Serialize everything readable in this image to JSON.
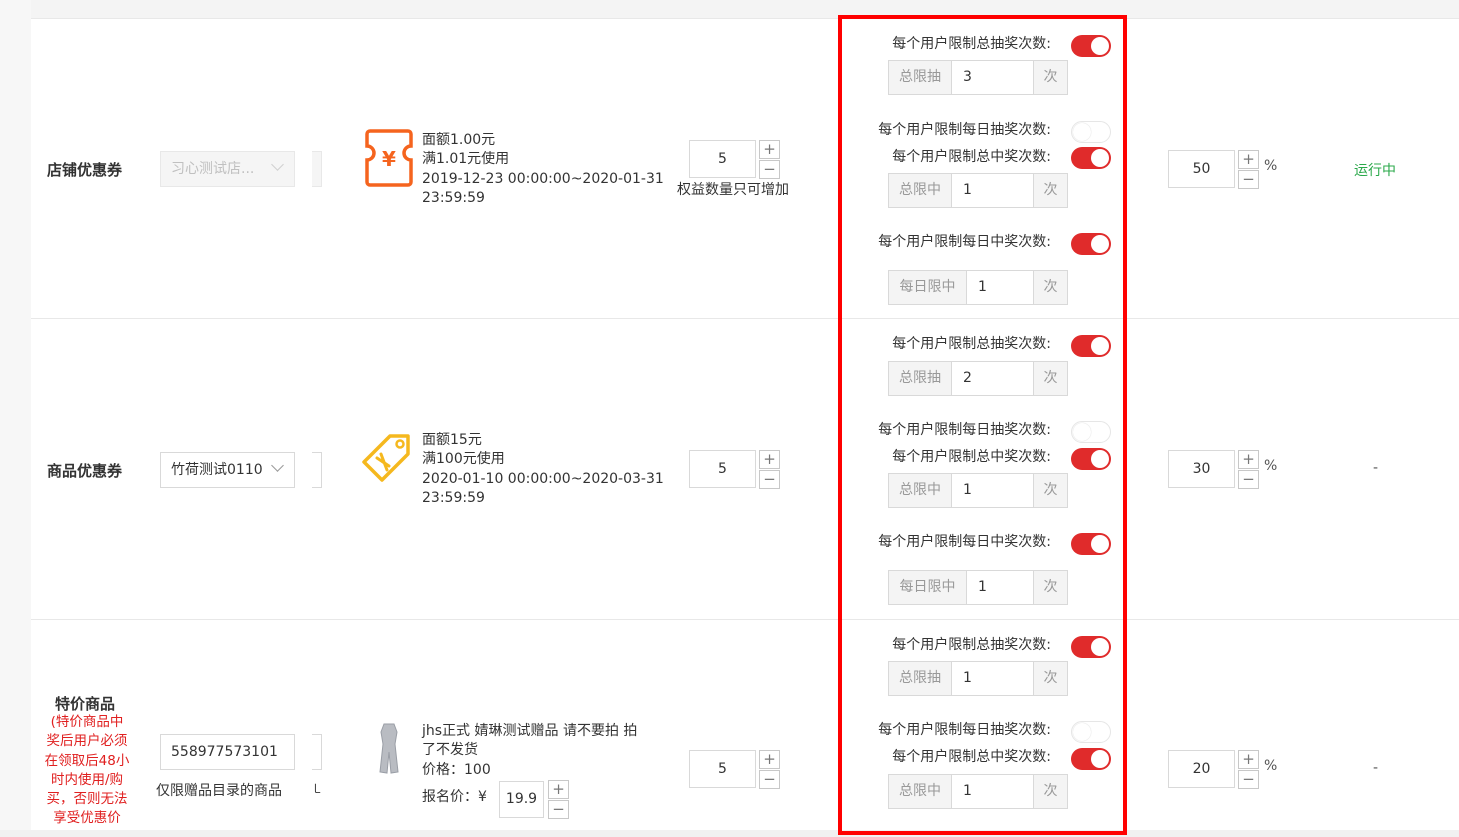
{
  "colors": {
    "accent_red": "#e02b2b",
    "highlight_border": "#ff0000",
    "status_running": "#2aa84a"
  },
  "rows": [
    {
      "category": "店铺优惠券",
      "store_select": {
        "value": "习心测试店...",
        "disabled": true
      },
      "icon": "coupon-yen-icon",
      "benefit": {
        "line1": "面额1.00元",
        "line2": "满1.01元使用",
        "line3": "2019-12-23 00:00:00~2020-01-31",
        "line4": "23:59:59"
      },
      "quantity": "5",
      "quantity_note": "权益数量只可增加",
      "limits": {
        "total_draw_label": "每个用户限制总抽奖次数:",
        "total_draw_on": true,
        "total_draw_prefix": "总限抽",
        "total_draw_value": "3",
        "total_draw_unit": "次",
        "daily_draw_label": "每个用户限制每日抽奖次数:",
        "daily_draw_on": false,
        "total_win_label": "每个用户限制总中奖次数:",
        "total_win_on": true,
        "total_win_prefix": "总限中",
        "total_win_value": "1",
        "total_win_unit": "次",
        "daily_win_label": "每个用户限制每日中奖次数:",
        "daily_win_on": true,
        "daily_win_prefix": "每日限中",
        "daily_win_value": "1",
        "daily_win_unit": "次"
      },
      "probability": "50",
      "percent_sign": "%",
      "status": "运行中"
    },
    {
      "category": "商品优惠券",
      "store_select": {
        "value": "竹荷测试0110",
        "disabled": false
      },
      "icon": "price-tag-icon",
      "benefit": {
        "line1": "面额15元",
        "line2": "满100元使用",
        "line3": "2020-01-10 00:00:00~2020-03-31",
        "line4": "23:59:59"
      },
      "quantity": "5",
      "limits": {
        "total_draw_label": "每个用户限制总抽奖次数:",
        "total_draw_on": true,
        "total_draw_prefix": "总限抽",
        "total_draw_value": "2",
        "total_draw_unit": "次",
        "daily_draw_label": "每个用户限制每日抽奖次数:",
        "daily_draw_on": false,
        "total_win_label": "每个用户限制总中奖次数:",
        "total_win_on": true,
        "total_win_prefix": "总限中",
        "total_win_value": "1",
        "total_win_unit": "次",
        "daily_win_label": "每个用户限制每日中奖次数:",
        "daily_win_on": true,
        "daily_win_prefix": "每日限中",
        "daily_win_value": "1",
        "daily_win_unit": "次"
      },
      "probability": "30",
      "percent_sign": "%",
      "status": "-"
    },
    {
      "category": "特价商品",
      "category_note": [
        "(特价商品中",
        "奖后用户必须",
        "在领取后48小",
        "时内使用/购",
        "买，否则无法",
        "享受优惠价"
      ],
      "item_input": "558977573101",
      "item_note": "仅限赠品目录的商品",
      "item_note_tail": "㇄",
      "icon": "product-thumbnail-icon",
      "product": {
        "title1": "jhs正式 婧琳测试赠品 请不要拍 拍",
        "title2": "了不发货",
        "price": "价格：100",
        "signup_label": "报名价：¥",
        "signup_value": "19.9"
      },
      "quantity": "5",
      "limits": {
        "total_draw_label": "每个用户限制总抽奖次数:",
        "total_draw_on": true,
        "total_draw_prefix": "总限抽",
        "total_draw_value": "1",
        "total_draw_unit": "次",
        "daily_draw_label": "每个用户限制每日抽奖次数:",
        "daily_draw_on": false,
        "total_win_label": "每个用户限制总中奖次数:",
        "total_win_on": true,
        "total_win_prefix": "总限中",
        "total_win_value": "1",
        "total_win_unit": "次"
      },
      "probability": "20",
      "percent_sign": "%",
      "status": "-"
    }
  ],
  "stepper": {
    "plus": "+",
    "minus": "−"
  }
}
